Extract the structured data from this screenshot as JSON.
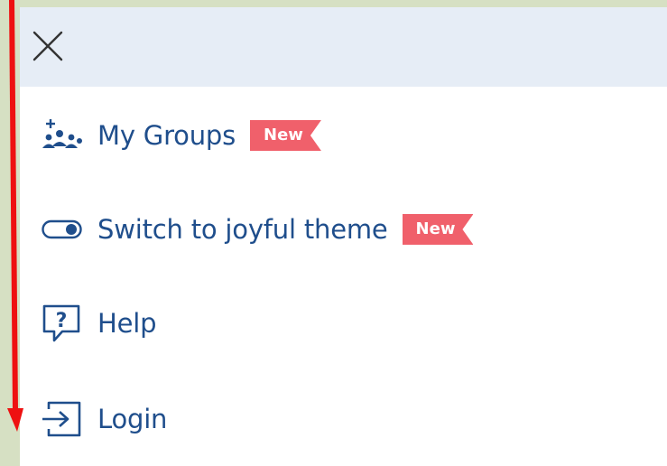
{
  "menu": {
    "items": [
      {
        "label": "My Groups",
        "icon": "groups-icon",
        "badge": "New"
      },
      {
        "label": "Switch to joyful theme",
        "icon": "toggle-icon",
        "badge": "New"
      },
      {
        "label": "Help",
        "icon": "help-icon"
      },
      {
        "label": "Login",
        "icon": "login-icon"
      }
    ]
  },
  "colors": {
    "accent": "#1f4e8c",
    "badge": "#f0606b",
    "header_bg": "#e6edf6",
    "annotation_arrow": "#ee1111"
  }
}
